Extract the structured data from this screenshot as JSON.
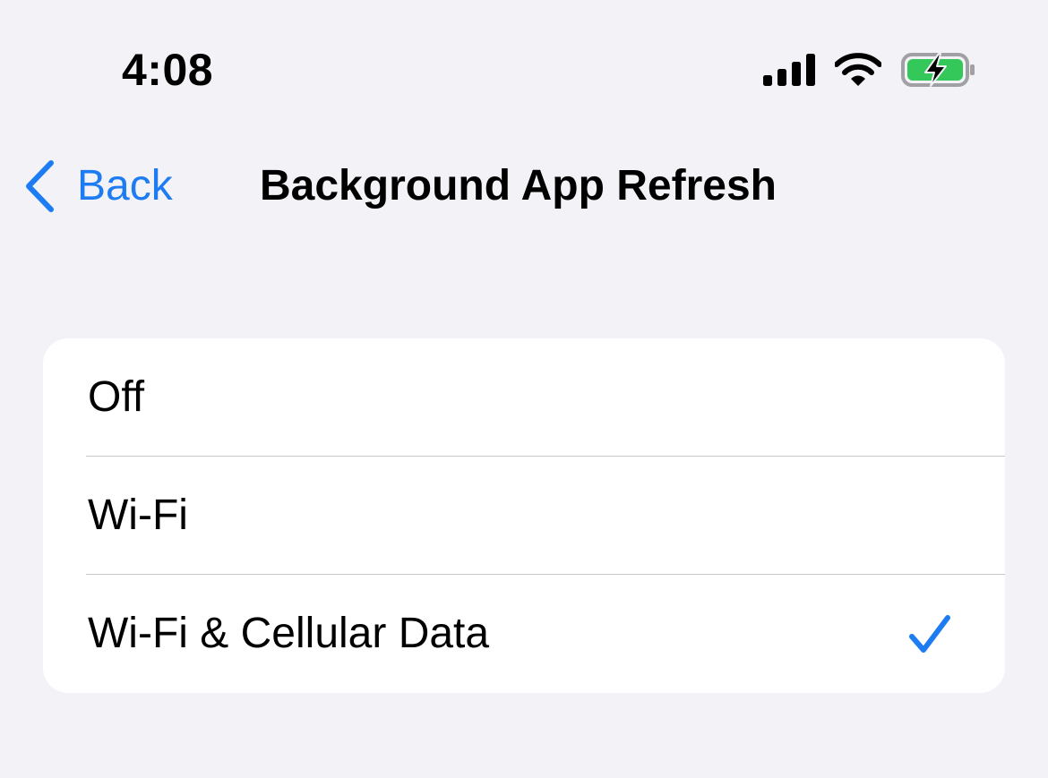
{
  "status_bar": {
    "time": "4:08",
    "icons": [
      "cellular-signal-icon",
      "wifi-icon",
      "battery-charging-icon"
    ]
  },
  "nav": {
    "back_label": "Back",
    "title": "Background App Refresh"
  },
  "options": [
    {
      "label": "Off",
      "selected": false
    },
    {
      "label": "Wi-Fi",
      "selected": false
    },
    {
      "label": "Wi-Fi & Cellular Data",
      "selected": true
    }
  ],
  "colors": {
    "accent": "#1e7cf2",
    "background": "#f2f2f7",
    "group_background": "#ffffff",
    "separator": "#c6c6c8",
    "battery_fill": "#34c759"
  }
}
